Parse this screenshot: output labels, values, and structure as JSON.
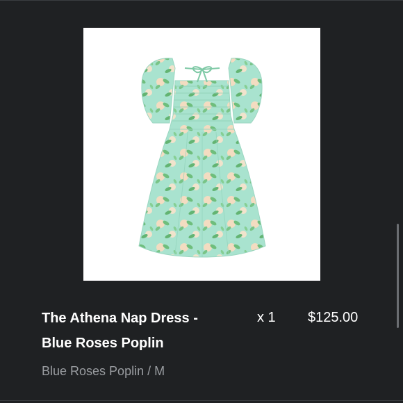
{
  "product": {
    "title_line1": "The Athena Nap Dress -",
    "title_line2": "Blue Roses Poplin",
    "quantity": "x 1",
    "price": "$125.00",
    "variant": "Blue Roses Poplin / M",
    "image_icon": "dress-image"
  },
  "colors": {
    "background": "#1f2123",
    "text_primary": "#ffffff",
    "text_secondary": "#9a9da1",
    "dress_mint": "#a9e3cf",
    "print_green": "#6fbe7c",
    "print_rose": "#f3dcc1"
  }
}
